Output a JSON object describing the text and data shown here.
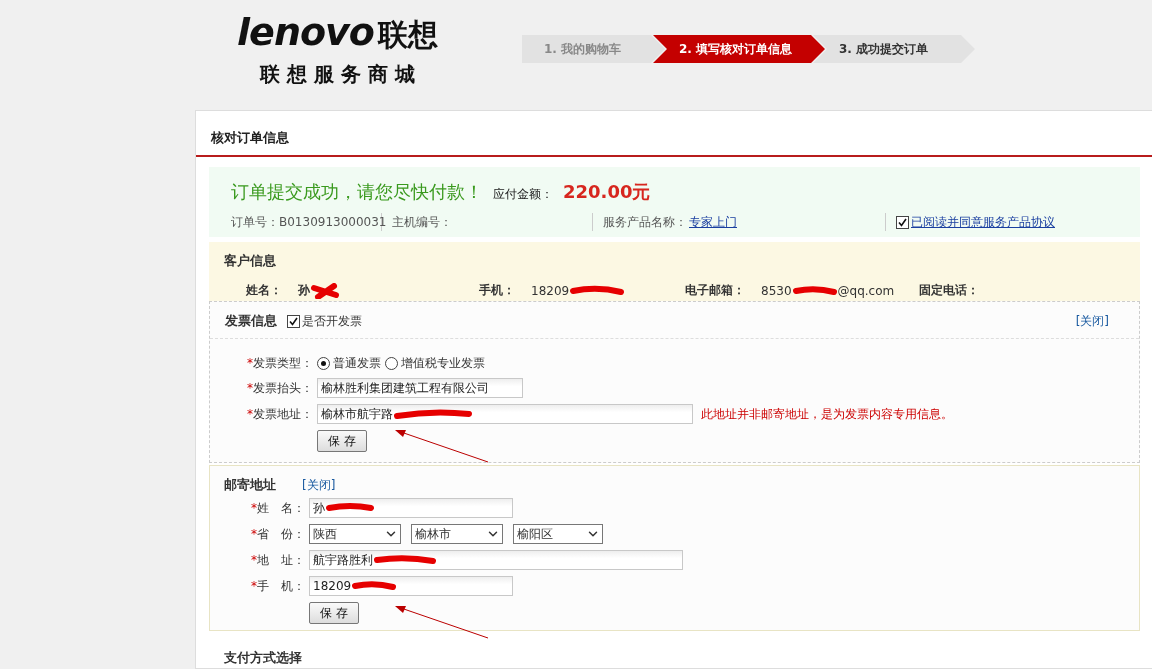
{
  "logo": {
    "wordmark": "lenovo",
    "brand_cn": "联想",
    "subtitle": "联 想 服 务 商 城"
  },
  "steps": [
    {
      "label": "1. 我的购物车",
      "selected": false
    },
    {
      "label": "2. 填写核对订单信息",
      "selected": true
    },
    {
      "label": "3. 成功提交订单",
      "selected": false
    }
  ],
  "panel_title": "核对订单信息",
  "success": {
    "message": "订单提交成功，请您尽快付款！",
    "amount_label": "应付金额：",
    "amount": "220.00元",
    "order_no": "订单号：B0130913000031",
    "host_no": "主机编号：",
    "product_label": "服务产品名称：",
    "product_link": "专家上门",
    "agree_checked": true,
    "agree_link": "已阅读并同意服务产品协议"
  },
  "customer": {
    "title": "客户信息",
    "fields": [
      {
        "label": "姓名：",
        "value": "孙",
        "redacted": true
      },
      {
        "label": "手机：",
        "value": "18209",
        "redacted": true
      },
      {
        "label": "电子邮箱：",
        "value": "8530",
        "suffix": "@qq.com",
        "redacted": true
      },
      {
        "label": "固定电话："
      }
    ]
  },
  "invoice": {
    "title": "发票信息",
    "toggle_label": "是否开发票",
    "toggle_checked": true,
    "close_link": "[关闭]",
    "type_label": {
      "mark": "*",
      "text": "发票类型："
    },
    "types": [
      {
        "label": "普通发票",
        "selected": true
      },
      {
        "label": "增值税专业发票",
        "selected": false
      }
    ],
    "header_label": {
      "mark": "*",
      "text": "发票抬头："
    },
    "header_value": "榆林胜利集团建筑工程有限公司",
    "address_label": {
      "mark": "*",
      "text": "发票地址："
    },
    "address_value": "榆林市航宇路",
    "address_redacted": true,
    "address_note": "此地址并非邮寄地址，是为发票内容专用信息。",
    "save": "保 存"
  },
  "mailing": {
    "title": "邮寄地址",
    "close_link": "[关闭]",
    "name_label": {
      "mark": "*",
      "text": "姓　名："
    },
    "name_value": "孙",
    "province_label": {
      "mark": "*",
      "text": "省　份："
    },
    "selects": [
      "陕西",
      "榆林市",
      "榆阳区"
    ],
    "address_label": {
      "mark": "*",
      "text": "地　址："
    },
    "address_value": "航宇路胜利",
    "phone_label": {
      "mark": "*",
      "text": "手　机："
    },
    "phone_value": "18209",
    "redacted": true,
    "save": "保 存"
  },
  "payment_title": "支付方式选择"
}
